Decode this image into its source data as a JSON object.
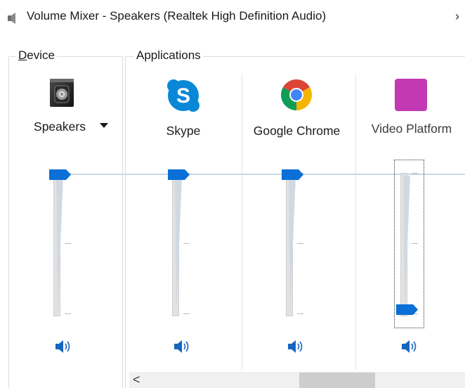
{
  "window": {
    "title": "Volume Mixer - Speakers (Realtek High Definition Audio)",
    "more_arrow": "›"
  },
  "device": {
    "legend_accesskey": "D",
    "legend_rest": "evice",
    "name": "Speakers",
    "icon": "speaker-device-icon",
    "volume_percent": 100
  },
  "applications": {
    "legend": "Applications",
    "items": [
      {
        "label": "Skype",
        "icon": "skype-icon",
        "color": "#0078d4",
        "volume_percent": 100
      },
      {
        "label": "Google Chrome",
        "icon": "chrome-icon",
        "color": "#4285f4",
        "volume_percent": 100
      },
      {
        "label": "Video Platform",
        "icon": "video-platform-icon",
        "color": "#c239b3",
        "volume_percent": 0
      }
    ]
  },
  "scrollbar": {
    "left_arrow": "<"
  },
  "colors": {
    "accent": "#0a6fd6",
    "track": "#e2e2e2",
    "peak_line": "#c9d8e6"
  }
}
